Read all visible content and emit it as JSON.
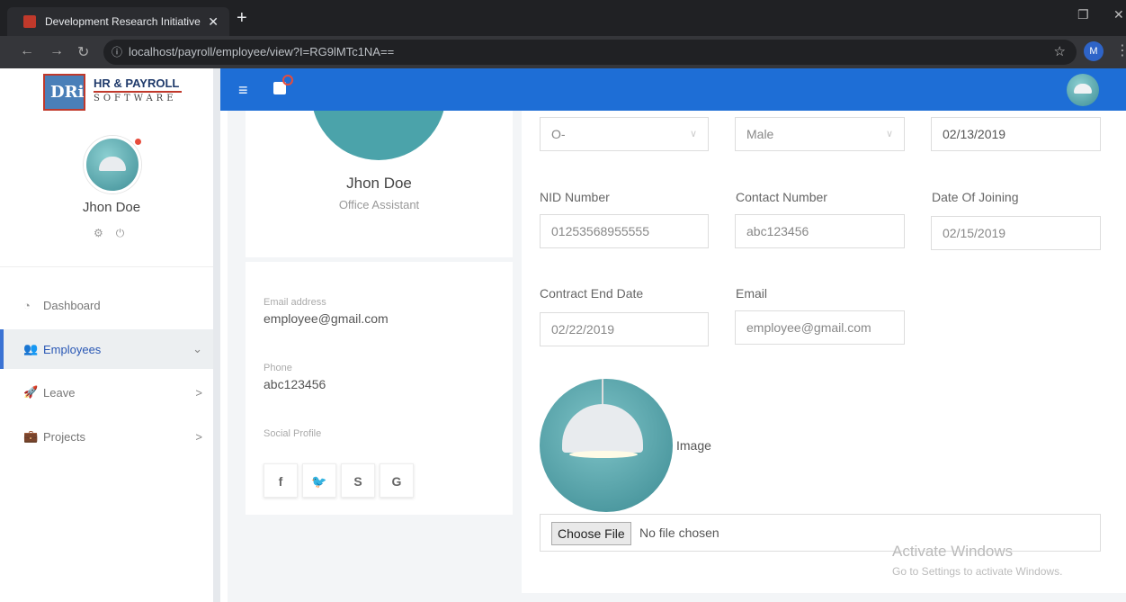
{
  "browser": {
    "tab_title": "Development Research Initiative",
    "tab_close": "✕",
    "new_tab": "+",
    "url": "localhost/payroll/employee/view?I=RG9lMTc1NA==",
    "profile_initial": "M"
  },
  "brand": {
    "logo_text": "DRi",
    "title": "HR & PAYROLL",
    "subtitle": "SOFTWARE"
  },
  "sidebar": {
    "user_name": "Jhon Doe",
    "items": [
      {
        "label": "Dashboard",
        "icon": "dashboard-icon",
        "glyph": "◔",
        "chevron": ""
      },
      {
        "label": "Employees",
        "icon": "users-icon",
        "glyph": "👥",
        "chevron": "⌄"
      },
      {
        "label": "Leave",
        "icon": "rocket-icon",
        "glyph": "🚀",
        "chevron": ">"
      },
      {
        "label": "Projects",
        "icon": "briefcase-icon",
        "glyph": "💼",
        "chevron": ">"
      }
    ]
  },
  "profile": {
    "name": "Jhon Doe",
    "role": "Office Assistant",
    "email_label": "Email address",
    "email": "employee@gmail.com",
    "phone_label": "Phone",
    "phone": "abc123456",
    "social_label": "Social Profile",
    "social": [
      "f",
      "🐦",
      "S",
      "G"
    ]
  },
  "form": {
    "blood_group": "O-",
    "gender": "Male",
    "dob": "02/13/2019",
    "nid_label": "NID Number",
    "nid": "01253568955555",
    "contact_label": "Contact Number",
    "contact": "abc123456",
    "joining_label": "Date Of Joining",
    "joining": "02/15/2019",
    "contract_end_label": "Contract End Date",
    "contract_end": "02/22/2019",
    "email_label": "Email",
    "email": "employee@gmail.com",
    "image_label": "Image",
    "choose_file": "Choose File",
    "no_file": "No file chosen"
  },
  "watermark": {
    "line1": "Activate Windows",
    "line2": "Go to Settings to activate Windows."
  },
  "colors": {
    "header_blue": "#1e6ed6",
    "active_blue": "#2a58b5",
    "avatar_teal": "#4ba3aa"
  }
}
